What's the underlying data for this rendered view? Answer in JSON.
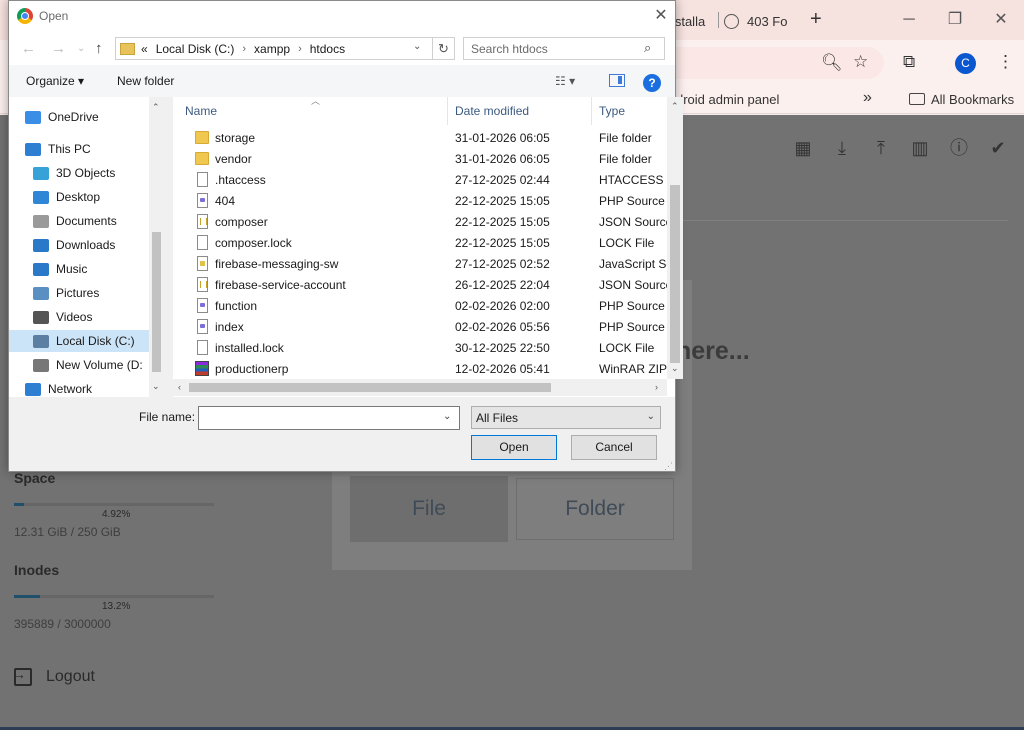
{
  "browser": {
    "tabs": [
      {
        "label": "Installa",
        "partial": true
      },
      {
        "label": "403 Fo"
      }
    ],
    "new_tab_symbol": "+",
    "window_controls": {
      "minimize": "─",
      "restore": "❐",
      "close": "✕"
    },
    "avatar_letter": "C",
    "bookmarks_bar": {
      "item_partial": "droid admin panel",
      "more_symbol": "»",
      "all_bookmarks": "All Bookmarks"
    }
  },
  "page": {
    "drop_text": "here...",
    "choices": {
      "file": "File",
      "folder": "Folder"
    },
    "storage": {
      "space_title": "Space",
      "space_percent": "4.92%",
      "space_fraction": 0.0492,
      "space_detail": "12.31 GiB / 250 GiB",
      "inodes_title": "Inodes",
      "inodes_percent": "13.2%",
      "inodes_fraction": 0.132,
      "inodes_detail": "395889 / 3000000"
    },
    "logout_label": "Logout"
  },
  "dialog": {
    "title": "Open",
    "close_symbol": "✕",
    "breadcrumb": {
      "overflow": "«",
      "parts": [
        "Local Disk (C:)",
        "xampp",
        "htdocs"
      ],
      "separator": "›"
    },
    "search_placeholder": "Search htdocs",
    "commands": {
      "organize": "Organize ▾",
      "new_folder": "New folder"
    },
    "help_symbol": "?",
    "nav_items": [
      {
        "label": "OneDrive",
        "icon": "cloud-icon",
        "color": "#3a8ee6"
      },
      {
        "label": "This PC",
        "icon": "pc-icon",
        "color": "#2e7fd1"
      },
      {
        "label": "3D Objects",
        "icon": "cube-icon",
        "color": "#36a2d8"
      },
      {
        "label": "Desktop",
        "icon": "desktop-icon",
        "color": "#2f86d6"
      },
      {
        "label": "Documents",
        "icon": "documents-icon",
        "color": "#9a9a9a"
      },
      {
        "label": "Downloads",
        "icon": "download-icon",
        "color": "#2a78c8"
      },
      {
        "label": "Music",
        "icon": "music-icon",
        "color": "#2a78c8"
      },
      {
        "label": "Pictures",
        "icon": "pictures-icon",
        "color": "#5a8fc2"
      },
      {
        "label": "Videos",
        "icon": "videos-icon",
        "color": "#555555"
      },
      {
        "label": "Local Disk (C:)",
        "icon": "drive-icon",
        "color": "#5b7fa3",
        "selected": true
      },
      {
        "label": "New Volume (D:",
        "icon": "drive-icon",
        "color": "#777777"
      },
      {
        "label": "Network",
        "icon": "network-icon",
        "color": "#2e7fd1"
      }
    ],
    "columns": {
      "name": "Name",
      "date": "Date modified",
      "type": "Type"
    },
    "files": [
      {
        "name": "storage",
        "date": "31-01-2026 06:05",
        "type": "File folder",
        "kind": "folder"
      },
      {
        "name": "vendor",
        "date": "31-01-2026 06:05",
        "type": "File folder",
        "kind": "folder"
      },
      {
        "name": ".htaccess",
        "date": "27-12-2025 02:44",
        "type": "HTACCESS Fi",
        "kind": "doc"
      },
      {
        "name": "404",
        "date": "22-12-2025 15:05",
        "type": "PHP Source F",
        "kind": "php"
      },
      {
        "name": "composer",
        "date": "22-12-2025 15:05",
        "type": "JSON Source",
        "kind": "json"
      },
      {
        "name": "composer.lock",
        "date": "22-12-2025 15:05",
        "type": "LOCK File",
        "kind": "doc"
      },
      {
        "name": "firebase-messaging-sw",
        "date": "27-12-2025 02:52",
        "type": "JavaScript So",
        "kind": "js"
      },
      {
        "name": "firebase-service-account",
        "date": "26-12-2025 22:04",
        "type": "JSON Source",
        "kind": "json"
      },
      {
        "name": "function",
        "date": "02-02-2026 02:00",
        "type": "PHP Source F",
        "kind": "php"
      },
      {
        "name": "index",
        "date": "02-02-2026 05:56",
        "type": "PHP Source F",
        "kind": "php"
      },
      {
        "name": "installed.lock",
        "date": "30-12-2025 22:50",
        "type": "LOCK File",
        "kind": "doc"
      },
      {
        "name": "productionerp",
        "date": "12-02-2026 05:41",
        "type": "WinRAR ZIP a",
        "kind": "rar"
      }
    ],
    "file_name_label": "File name:",
    "file_name_value": "",
    "file_type_filter": "All Files",
    "buttons": {
      "open": "Open",
      "cancel": "Cancel"
    }
  }
}
